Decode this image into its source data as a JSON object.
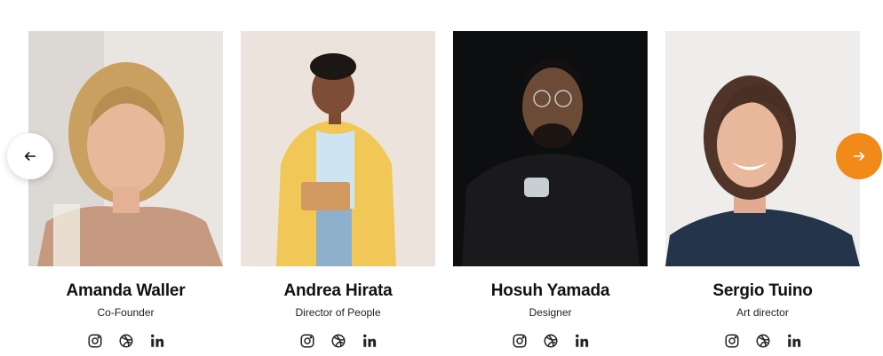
{
  "team": {
    "members": [
      {
        "name": "Amanda Waller",
        "role": "Co-Founder",
        "photo": "portrait-woman-blonde-beige-blazer"
      },
      {
        "name": "Andrea Hirata",
        "role": "Director of People",
        "photo": "portrait-woman-yellow-blazer-tablet"
      },
      {
        "name": "Hosuh Yamada",
        "role": "Designer",
        "photo": "portrait-man-black-shirt-dark-bg"
      },
      {
        "name": "Sergio Tuino",
        "role": "Art director",
        "photo": "portrait-man-smiling-navy-sweater"
      }
    ],
    "social_icons": [
      "instagram-icon",
      "dribbble-icon",
      "linkedin-icon"
    ]
  },
  "carousel": {
    "prev_icon": "arrow-left-icon",
    "next_icon": "arrow-right-icon",
    "next_color": "#f28a1a"
  }
}
